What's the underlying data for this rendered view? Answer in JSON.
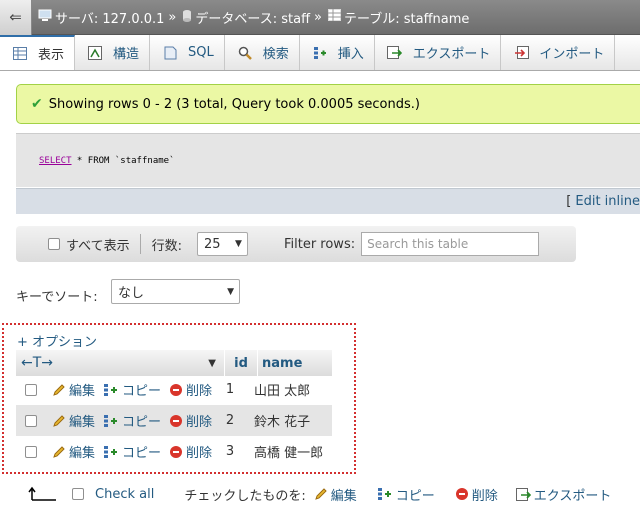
{
  "breadcrumb": {
    "server": "サーバ: 127.0.0.1",
    "database": "データベース: staff",
    "table": "テーブル: staffname",
    "separator": "»"
  },
  "tabs": [
    {
      "label": "表示",
      "icon": "table-icon",
      "active": true
    },
    {
      "label": "構造",
      "icon": "structure-icon"
    },
    {
      "label": "SQL",
      "icon": "sql-icon"
    },
    {
      "label": "検索",
      "icon": "search-icon"
    },
    {
      "label": "挿入",
      "icon": "insert-icon"
    },
    {
      "label": "エクスポート",
      "icon": "export-icon"
    },
    {
      "label": "インポート",
      "icon": "import-icon"
    }
  ],
  "success": {
    "message": "Showing rows 0 - 2 (3 total, Query took 0.0005 seconds.)"
  },
  "sql": {
    "keyword_select": "SELECT",
    "rest1": " * ",
    "keyword_from": "FROM",
    "table": " `staffname`"
  },
  "sql_bar": {
    "bracket_open": "[",
    "edit_inline": "Edit inline"
  },
  "navbar": {
    "show_all": "すべて表示",
    "rows_label": "行数:",
    "rows_value": "25",
    "filter_label": "Filter rows:",
    "filter_placeholder": "Search this table"
  },
  "sort": {
    "label": "キーでソート:",
    "value": "なし"
  },
  "options": {
    "label": "+ オプション"
  },
  "table": {
    "columns": [
      "id",
      "name"
    ],
    "arrows": "←T→",
    "edit_label": "編集",
    "copy_label": "コピー",
    "delete_label": "削除",
    "rows": [
      {
        "id": "1",
        "name": "山田 太郎"
      },
      {
        "id": "2",
        "name": "鈴木 花子"
      },
      {
        "id": "3",
        "name": "高橋 健一郎"
      }
    ]
  },
  "bottom": {
    "check_all": "Check all",
    "with_selected": "チェックしたものを:",
    "edit": "編集",
    "copy": "コピー",
    "delete": "削除",
    "export": "エクスポート"
  },
  "colors": {
    "accent": "#235a81",
    "success_bg": "#ebf8a4",
    "delete_red": "#d9352b"
  }
}
